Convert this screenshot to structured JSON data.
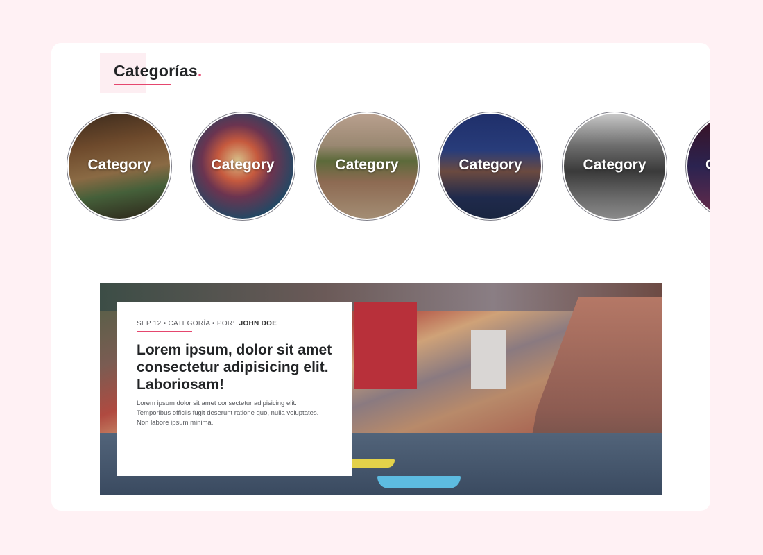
{
  "section": {
    "title": "Categorías",
    "title_dot": ".",
    "accent_color": "#e5466e",
    "background_color": "#fff1f4"
  },
  "categories": [
    {
      "label": "Category"
    },
    {
      "label": "Category"
    },
    {
      "label": "Category"
    },
    {
      "label": "Category"
    },
    {
      "label": "Category"
    },
    {
      "label": "C"
    }
  ],
  "featured_post": {
    "date": "SEP 12",
    "separator": "•",
    "category": "CATEGORÍA",
    "by_label": "POR:",
    "author": "JOHN DOE",
    "title": "Lorem ipsum, dolor sit amet consectetur adipisicing elit. Laboriosam!",
    "excerpt": "Lorem ipsum dolor sit amet consectetur adipisicing elit. Temporibus officiis fugit deserunt ratione quo, nulla voluptates. Non labore ipsum minima."
  }
}
